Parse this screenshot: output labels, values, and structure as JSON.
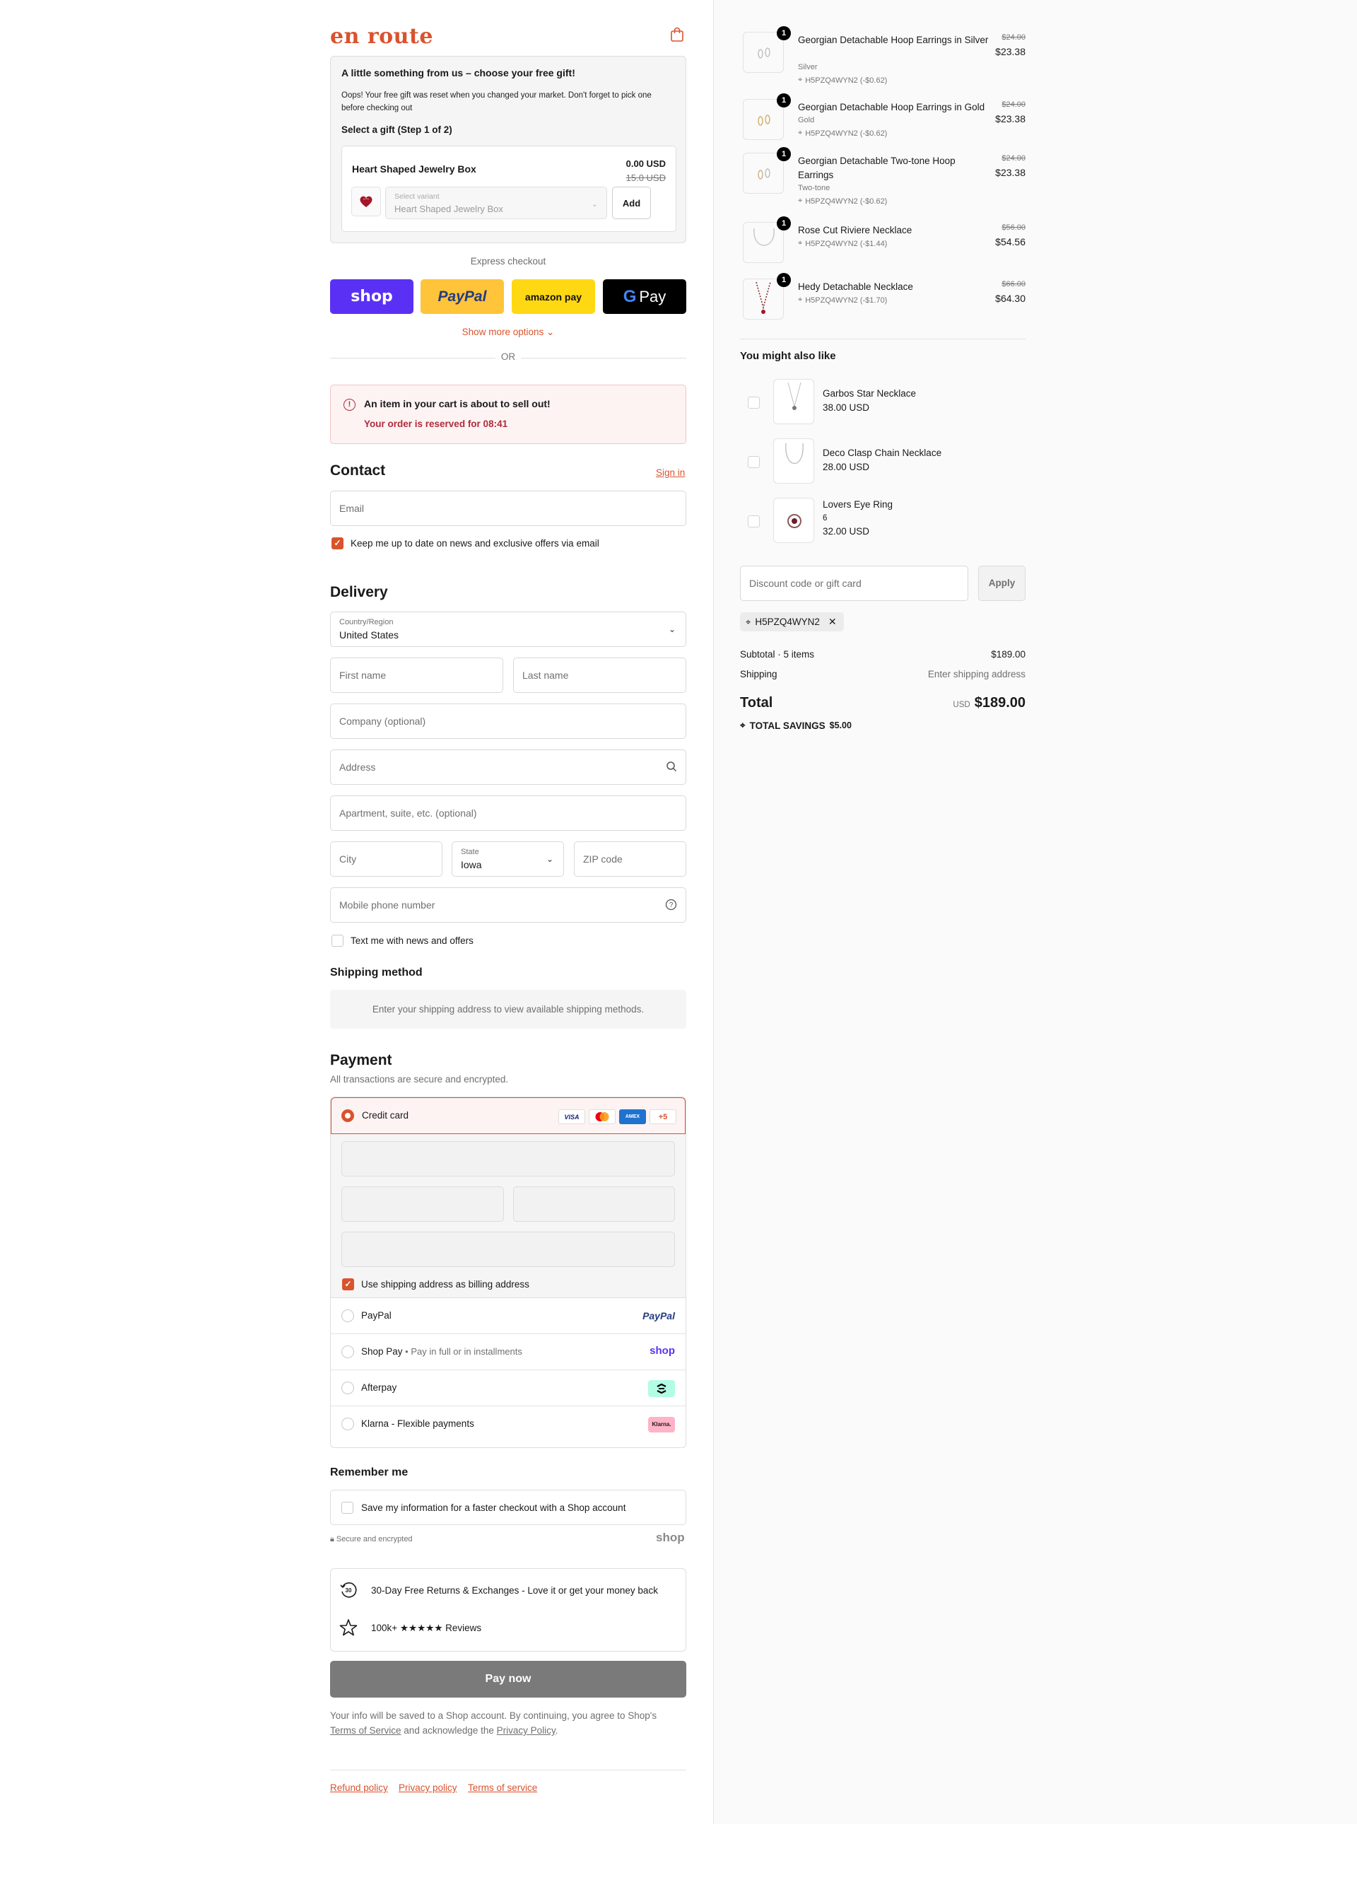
{
  "brand": {
    "logo_text": "en route",
    "accent": "#d9532e"
  },
  "gift": {
    "title": "A little something from us – choose your free gift!",
    "note": "Oops! Your free gift was reset when you changed your market. Don't forget to pick one before checking out",
    "step": "Select a gift (Step 1 of 2)",
    "product_name": "Heart Shaped Jewelry Box",
    "price": "0.00 USD",
    "old_price": "15.0 USD",
    "variant_label": "Select variant",
    "variant_value": "Heart Shaped Jewelry Box",
    "add_label": "Add"
  },
  "express": {
    "title": "Express checkout",
    "shop": "shop",
    "paypal": "PayPal",
    "amazon": "amazon pay",
    "gpay": "Pay",
    "gpay_g": "G",
    "more": "Show more options",
    "or": "OR"
  },
  "alert": {
    "title": "An item in your cart is about to sell out!",
    "reserved": "Your order is reserved for 08:41"
  },
  "contact": {
    "heading": "Contact",
    "sign_in": "Sign in",
    "email_placeholder": "Email",
    "news_label": "Keep me up to date on news and exclusive offers via email"
  },
  "delivery": {
    "heading": "Delivery",
    "country_label": "Country/Region",
    "country_value": "United States",
    "first_name": "First name",
    "last_name": "Last name",
    "company": "Company (optional)",
    "address": "Address",
    "apartment": "Apartment, suite, etc. (optional)",
    "city": "City",
    "state_label": "State",
    "state_value": "Iowa",
    "zip": "ZIP code",
    "phone": "Mobile phone number",
    "text_me": "Text me with news and offers"
  },
  "shipping": {
    "heading": "Shipping method",
    "message": "Enter your shipping address to view available shipping methods."
  },
  "payment": {
    "heading": "Payment",
    "subtitle": "All transactions are secure and encrypted.",
    "credit_card": "Credit card",
    "card_visa": "VISA",
    "card_amex": "AMEX",
    "card_more": "+5",
    "billing_same": "Use shipping address as billing address",
    "paypal": "PayPal",
    "paypal_logo": "PayPal",
    "shop_pay": "Shop Pay",
    "shop_pay_note": "Pay in full or in installments",
    "shop_logo": "shop",
    "afterpay": "Afterpay",
    "klarna": "Klarna - Flexible payments",
    "klarna_logo": "Klarna."
  },
  "remember": {
    "heading": "Remember me",
    "save_label": "Save my information for a faster checkout with a Shop account",
    "secure": "Secure and encrypted",
    "shop_logo": "shop"
  },
  "perks": [
    {
      "icon": "returns-30-icon",
      "badge": "30",
      "text": "30-Day Free Returns & Exchanges - Love it or get your money back"
    },
    {
      "icon": "star-icon",
      "text": "100k+ ★★★★★ Reviews"
    }
  ],
  "pay_now": "Pay now",
  "fine_print": {
    "before": "Your info will be saved to a Shop account. By continuing, you agree to Shop's",
    "terms": "Terms of Service",
    "middle": "and acknowledge the",
    "privacy": "Privacy Policy",
    "end": "."
  },
  "footer_links": [
    "Refund policy",
    "Privacy policy",
    "Terms of service"
  ],
  "cart": {
    "items": [
      {
        "name": "Georgian Detachable Hoop Earrings in Silver",
        "variant": "Silver",
        "discount": "H5PZQ4WYN2 (-$0.62)",
        "old_price": "$24.00",
        "price": "$23.38",
        "qty": "1"
      },
      {
        "name": "Georgian Detachable Hoop Earrings in Gold",
        "variant": "Gold",
        "discount": "H5PZQ4WYN2 (-$0.62)",
        "old_price": "$24.00",
        "price": "$23.38",
        "qty": "1"
      },
      {
        "name": "Georgian Detachable Two-tone Hoop Earrings",
        "variant": "Two-tone",
        "discount": "H5PZQ4WYN2 (-$0.62)",
        "old_price": "$24.00",
        "price": "$23.38",
        "qty": "1"
      },
      {
        "name": "Rose Cut Riviere Necklace",
        "variant": "",
        "discount": "H5PZQ4WYN2 (-$1.44)",
        "old_price": "$56.00",
        "price": "$54.56",
        "qty": "1"
      },
      {
        "name": "Hedy Detachable Necklace",
        "variant": "",
        "discount": "H5PZQ4WYN2 (-$1.70)",
        "old_price": "$66.00",
        "price": "$64.30",
        "qty": "1"
      }
    ],
    "suggest_heading": "You might also like",
    "suggestions": [
      {
        "name": "Garbos Star Necklace",
        "option": "",
        "price": "38.00 USD"
      },
      {
        "name": "Deco Clasp Chain Necklace",
        "option": "",
        "price": "28.00 USD"
      },
      {
        "name": "Lovers Eye Ring",
        "option": "6",
        "price": "32.00 USD"
      }
    ],
    "discount_placeholder": "Discount code or gift card",
    "apply": "Apply",
    "applied_code": "H5PZQ4WYN2",
    "subtotal_label": "Subtotal · 5 items",
    "subtotal_value": "$189.00",
    "shipping_label": "Shipping",
    "shipping_value": "Enter shipping address",
    "total_label": "Total",
    "currency": "USD",
    "total_value": "$189.00",
    "savings_label": "TOTAL SAVINGS",
    "savings_value": "$5.00"
  }
}
